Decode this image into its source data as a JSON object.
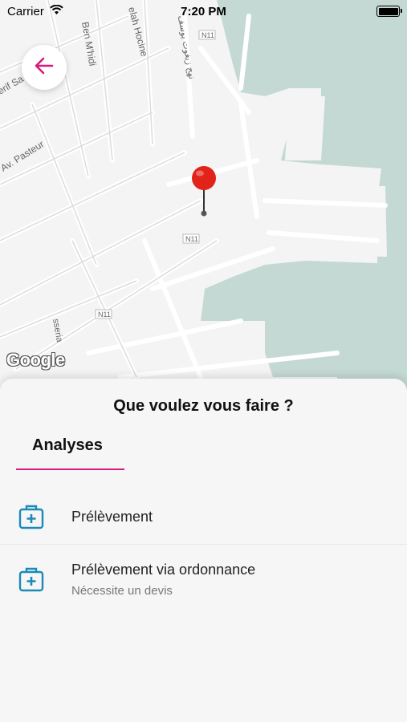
{
  "status_bar": {
    "carrier": "Carrier",
    "time": "7:20 PM"
  },
  "map": {
    "labels": {
      "ben_mhidi": "Ben M'hidi",
      "hocine": "elah Hocine",
      "pasteur": "Av. Pasteur",
      "sa": "erif Sa",
      "n11_top": "N11",
      "n11_mid": "N11",
      "n11_low": "N11",
      "rue_arabic": "نهج زيغوت يوسف",
      "serie": "sseria"
    },
    "attribution": "Google",
    "colors": {
      "water": "#c4d9d3",
      "land": "#f4f4f4",
      "road": "#ffffff",
      "pin": "#e2231a"
    }
  },
  "sheet": {
    "title": "Que voulez vous faire ?",
    "tab": {
      "label": "Analyses"
    },
    "items": [
      {
        "title": "Prélèvement",
        "subtitle": "",
        "icon": "medical-kit-icon"
      },
      {
        "title": "Prélèvement via ordonnance",
        "subtitle": "Nécessite un devis",
        "icon": "medical-kit-icon"
      }
    ],
    "colors": {
      "accent": "#d81b7a",
      "icon": "#1a8bb8"
    }
  }
}
